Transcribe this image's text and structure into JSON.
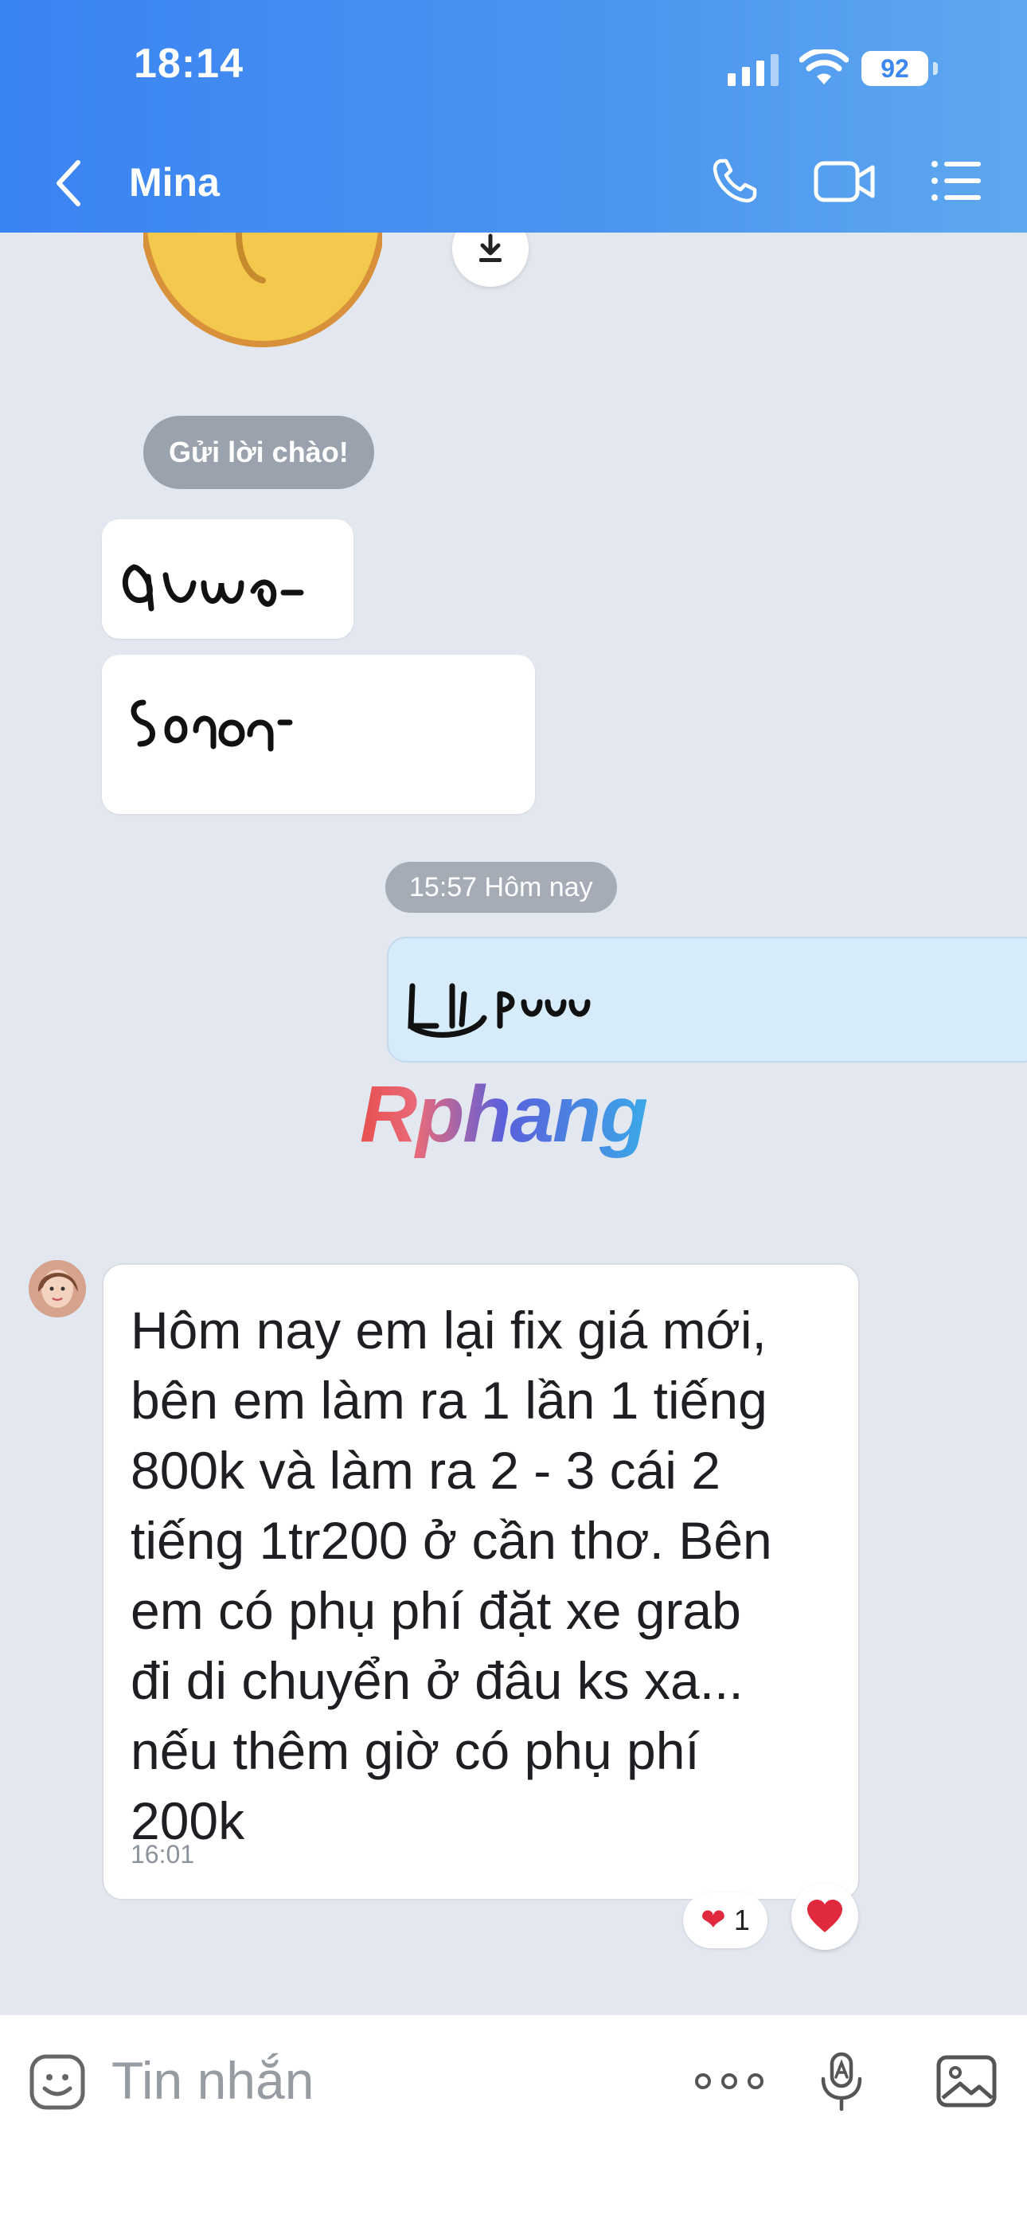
{
  "status_bar": {
    "time": "18:14",
    "battery": "92"
  },
  "header": {
    "contact_name": "Mina"
  },
  "chat": {
    "greet_chip": "Gửi lời chào!",
    "time_separator": "15:57 Hôm nay",
    "watermark": "Rphang",
    "message": {
      "text": "Hôm nay em lại fix giá mới,\nbên em làm ra 1 lần 1 tiếng\n800k và làm ra 2 - 3 cái 2\ntiếng 1tr200 ở cần thơ. Bên\nem có phụ phí đặt xe grab\nđi di chuyển ở đâu ks xa...\nnếu thêm giờ có phụ phí\n200k",
      "time": "16:01",
      "reaction_count": "1"
    }
  },
  "input_bar": {
    "placeholder": "Tin nhắn"
  },
  "colors": {
    "header": "#3a83f2",
    "heart": "#e0293c",
    "chat_bg": "#e3e7ef"
  }
}
